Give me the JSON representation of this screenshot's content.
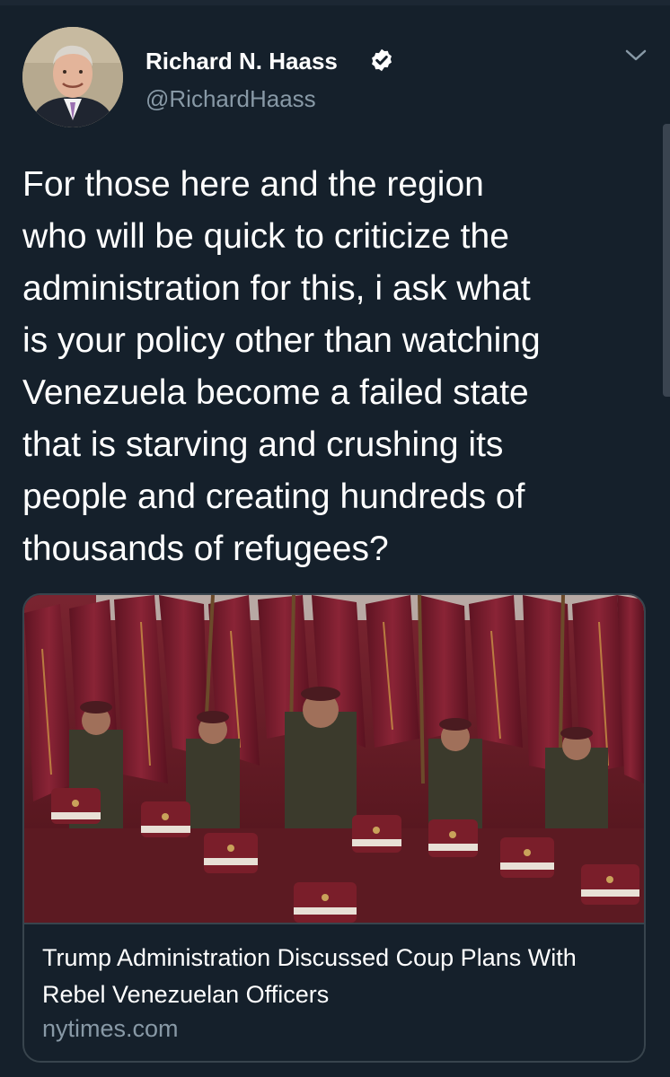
{
  "tweet": {
    "author_name": "Richard N. Haass",
    "author_handle": "@RichardHaass",
    "verified": true,
    "text": "For those here and the region\nwho will be quick to criticize the\nadministration for this, i ask what\nis your policy other than watching\nVenezuela become a failed state\nthat is starving and crushing its\npeople and creating hundreds of\nthousands of refugees?"
  },
  "card": {
    "title": "Trump Administration Discussed Coup Plans With Rebel Venezuelan Officers",
    "domain": "nytimes.com",
    "image_subject": "military-parade-photo"
  },
  "colors": {
    "background": "#15202b",
    "secondary_text": "#8899a6",
    "border": "#38444d",
    "verified_badge": "#ffffff"
  }
}
